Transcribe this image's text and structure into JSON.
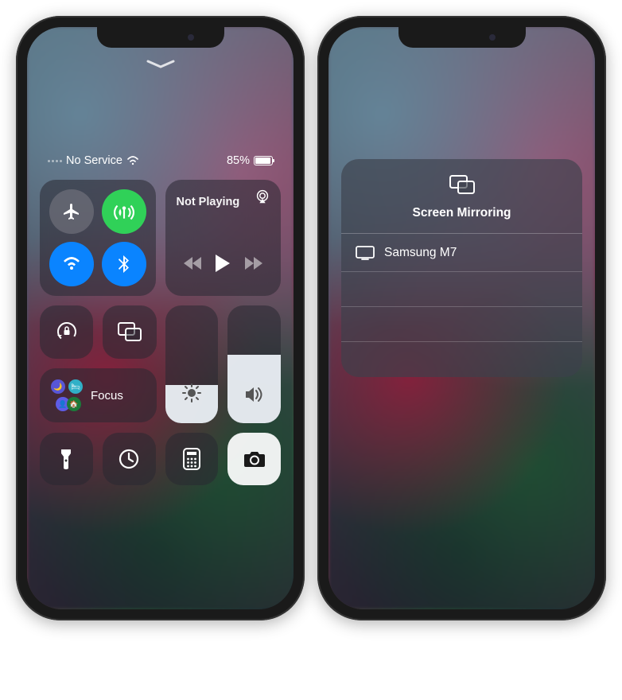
{
  "left": {
    "status": {
      "carrier": "No Service",
      "battery_pct": "85%"
    },
    "media": {
      "title": "Not Playing"
    },
    "focus": {
      "label": "Focus"
    },
    "sliders": {
      "brightness_fill_pct": 32,
      "volume_fill_pct": 58
    },
    "icons": {
      "airplane": "airplane-icon",
      "antenna": "cellular-antenna-icon",
      "wifi": "wifi-icon",
      "bluetooth": "bluetooth-icon",
      "airplay": "airplay-icon",
      "rewind": "rewind-icon",
      "play": "play-icon",
      "forward": "forward-icon",
      "orientation_lock": "orientation-lock-icon",
      "screen_mirroring": "screen-mirroring-icon",
      "brightness": "brightness-icon",
      "volume": "volume-icon",
      "flashlight": "flashlight-icon",
      "timer": "timer-icon",
      "calculator": "calculator-icon",
      "camera": "camera-icon"
    }
  },
  "right": {
    "panel": {
      "title": "Screen Mirroring",
      "devices": [
        {
          "name": "Samsung M7",
          "icon": "tv-icon"
        }
      ]
    }
  }
}
